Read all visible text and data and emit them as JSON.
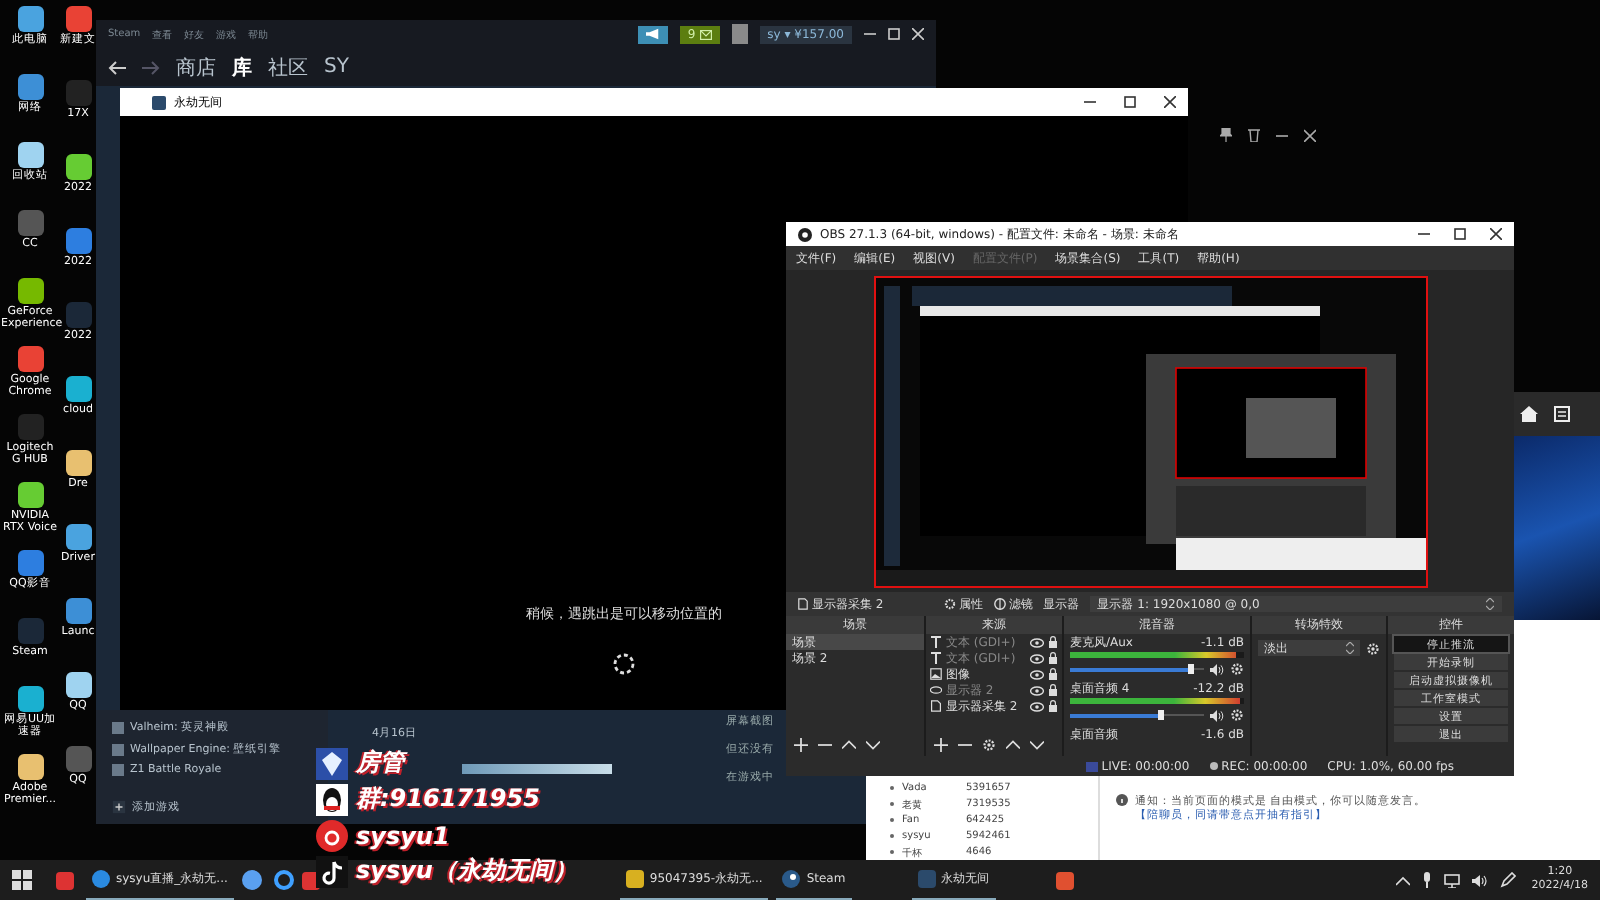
{
  "desktop": {
    "column_1": [
      {
        "label": "此电脑"
      },
      {
        "label": "网络"
      },
      {
        "label": "回收站"
      },
      {
        "label": "CC"
      },
      {
        "label": "GeForce Experience"
      },
      {
        "label": "Google Chrome"
      },
      {
        "label": "Logitech G HUB"
      },
      {
        "label": "NVIDIA RTX Voice"
      },
      {
        "label": "QQ影音"
      },
      {
        "label": "Steam"
      },
      {
        "label": "网易UU加速器"
      },
      {
        "label": "Adobe Premier..."
      }
    ],
    "column_2": [
      {
        "label": "新建文"
      },
      {
        "label": "17X"
      },
      {
        "label": "2022"
      },
      {
        "label": "2022"
      },
      {
        "label": "2022"
      },
      {
        "label": "cloud"
      },
      {
        "label": "Dre"
      },
      {
        "label": "Driver"
      },
      {
        "label": "Launc"
      },
      {
        "label": "QQ"
      },
      {
        "label": "QQ"
      }
    ]
  },
  "steam": {
    "menu": [
      "Steam",
      "查看",
      "好友",
      "游戏",
      "帮助"
    ],
    "notifications": "9",
    "account": "sy ▾ ¥157.00",
    "nav": [
      {
        "label": "商店",
        "selected": false
      },
      {
        "label": "库",
        "selected": true
      },
      {
        "label": "社区",
        "selected": false
      },
      {
        "label": "SY",
        "selected": false
      }
    ],
    "games": [
      "Valheim: 英灵神殿",
      "Wallpaper Engine: 壁纸引擎",
      "Z1 Battle Royale"
    ],
    "add_game": "添加游戏",
    "date": "4月16日",
    "screenshots": [
      "屏幕截图",
      "但还没有",
      "在游戏中"
    ]
  },
  "game_window": {
    "title": "永劫无间",
    "loading_text": "稍候，遇跳出是可以移动位置的"
  },
  "obs": {
    "title": "OBS 27.1.3 (64-bit, windows) - 配置文件: 未命名 - 场景: 未命名",
    "menu": [
      {
        "label": "文件(F)",
        "disabled": false
      },
      {
        "label": "编辑(E)",
        "disabled": false
      },
      {
        "label": "视图(V)",
        "disabled": false
      },
      {
        "label": "配置文件(P)",
        "disabled": true
      },
      {
        "label": "场景集合(S)",
        "disabled": false
      },
      {
        "label": "工具(T)",
        "disabled": false
      },
      {
        "label": "帮助(H)",
        "disabled": false
      }
    ],
    "source_toolbar": {
      "source": "显示器采集 2",
      "properties": "属性",
      "filters": "滤镜",
      "display_label": "显示器",
      "display_value": "显示器 1: 1920x1080 @ 0,0"
    },
    "scenes": {
      "title": "场景",
      "items": [
        {
          "label": "场景",
          "selected": true
        },
        {
          "label": "场景 2",
          "selected": false
        }
      ]
    },
    "sources": {
      "title": "来源",
      "items": [
        {
          "kind": "text",
          "label": "文本 (GDI+)",
          "visible": false
        },
        {
          "kind": "text",
          "label": "文本 (GDI+)",
          "visible": false
        },
        {
          "kind": "image",
          "label": "图像",
          "visible": true
        },
        {
          "kind": "display",
          "label": "显示器 2",
          "visible": false
        },
        {
          "kind": "capture",
          "label": "显示器采集 2",
          "visible": true
        }
      ]
    },
    "mixer": {
      "title": "混音器",
      "channels": [
        {
          "name": "麦克风/Aux",
          "reading": "-1.1 dB",
          "meter": {
            "level": 0.95
          },
          "fader": {
            "level": 0.92
          }
        },
        {
          "name": "桌面音频 4",
          "reading": "-12.2 dB",
          "meter": {
            "level": 0.98
          },
          "fader": {
            "level": 0.7
          }
        },
        {
          "name": "桌面音频",
          "reading": "-1.6 dB"
        }
      ]
    },
    "transitions": {
      "title": "转场特效",
      "value": "淡出"
    },
    "controls": {
      "title": "控件",
      "buttons": [
        {
          "label": "停止推流",
          "active": true
        },
        {
          "label": "开始录制",
          "active": false
        },
        {
          "label": "启动虚拟摄像机",
          "active": false
        },
        {
          "label": "工作室模式",
          "active": false
        },
        {
          "label": "设置",
          "active": false
        },
        {
          "label": "退出",
          "active": false
        }
      ]
    },
    "status": {
      "live": "LIVE: 00:00:00",
      "rec": "REC: 00:00:00",
      "cpu": "CPU: 1.0%, 60.00 fps"
    }
  },
  "web_panel": {
    "users": [
      {
        "name": "Vada",
        "value": "5391657"
      },
      {
        "name": "老黄",
        "value": "7319535"
      },
      {
        "name": "Fan",
        "value": "642425"
      },
      {
        "name": "sysyu",
        "value": "5942461"
      },
      {
        "name": "千杯",
        "value": "4646"
      }
    ],
    "notice": {
      "text": "通知：当前页面的模式是 自由模式，你可以随意发言。",
      "link": "【陪聊员，同请带意点开抽有指引】"
    }
  },
  "overlay": {
    "rows": [
      {
        "kind": "admin",
        "text": "房管"
      },
      {
        "kind": "qq",
        "text": "群:916171955"
      },
      {
        "kind": "netease",
        "text": "sysyu1"
      },
      {
        "kind": "douyin",
        "text": "sysyu（永劫无间）"
      }
    ]
  },
  "taskbar": {
    "tasks": [
      {
        "label": "sysyu直播_永劫无..."
      },
      {
        "label": "95047395-永劫无..."
      },
      {
        "label": "Steam"
      },
      {
        "label": "永劫无间"
      }
    ],
    "time": "1:20",
    "date": "2022/4/18"
  }
}
